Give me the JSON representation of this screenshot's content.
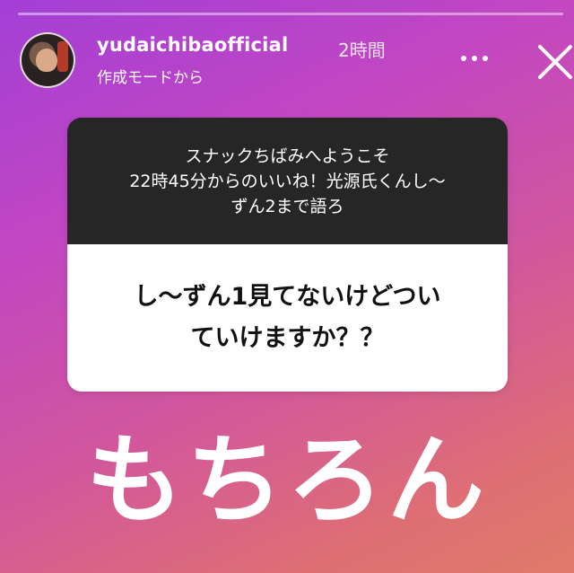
{
  "story": {
    "segments": 1,
    "username": "yudaichibaofficial",
    "time": "2時間",
    "subtitle": "作成モードから",
    "icons": {
      "more": "more-dots-icon",
      "close": "close-icon",
      "avatar": "profile-avatar"
    }
  },
  "question_card": {
    "prompt_lines": [
      "スナックちばみへようこそ",
      "22時45分からのいいね！光源氏くんし〜",
      "ずん2まで語ろ"
    ],
    "question_lines": [
      "し〜ずん1見てないけどつい",
      "ていけますか？？"
    ]
  },
  "answer": "もちろん",
  "colors": {
    "gradient_start": "#a23fd6",
    "gradient_end": "#e07a6a",
    "card_dark": "#262626",
    "card_light": "#ffffff"
  }
}
